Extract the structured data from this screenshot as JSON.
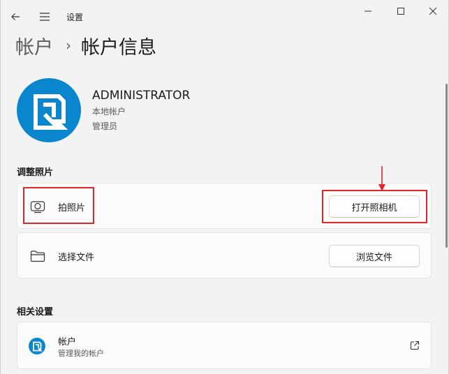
{
  "app": {
    "title": "设置"
  },
  "breadcrumb": {
    "parent": "帐户",
    "separator": "›",
    "current": "帐户信息"
  },
  "profile": {
    "name": "ADMINISTRATOR",
    "account_type": "本地帐户",
    "role": "管理员"
  },
  "adjust_photo": {
    "title": "调整照片",
    "take_photo": {
      "label": "拍照片",
      "icon": "camera-icon",
      "button": "打开照相机"
    },
    "choose_file": {
      "label": "选择文件",
      "icon": "folder-icon",
      "button": "浏览文件"
    }
  },
  "related": {
    "title": "相关设置",
    "accounts": {
      "title": "帐户",
      "subtitle": "管理我的帐户",
      "icon": "external-link-icon"
    }
  },
  "colors": {
    "accent": "#0a86cf",
    "highlight": "#e0262b"
  }
}
